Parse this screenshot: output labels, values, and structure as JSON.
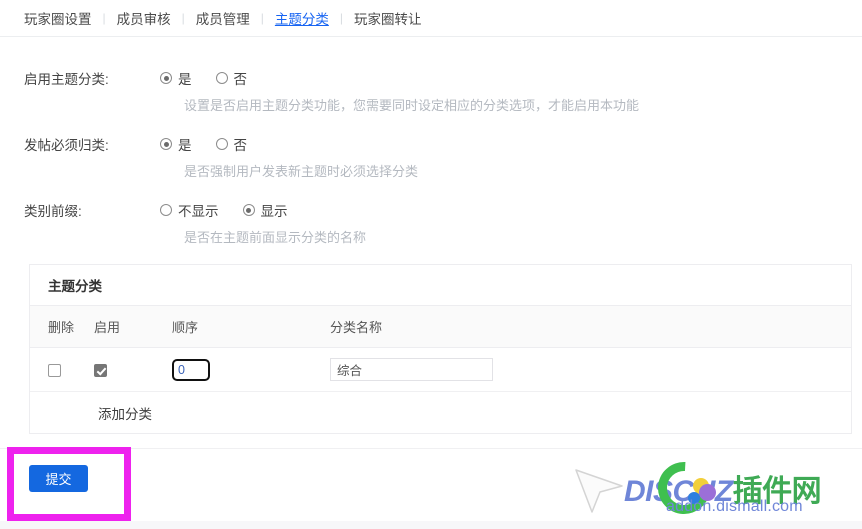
{
  "tabs": [
    {
      "label": "玩家圈设置",
      "active": false
    },
    {
      "label": "成员审核",
      "active": false
    },
    {
      "label": "成员管理",
      "active": false
    },
    {
      "label": "主题分类",
      "active": true
    },
    {
      "label": "玩家圈转让",
      "active": false
    }
  ],
  "separator": "|",
  "form": {
    "rows": [
      {
        "label": "启用主题分类:",
        "options": [
          {
            "label": "是",
            "selected": true
          },
          {
            "label": "否",
            "selected": false
          }
        ],
        "hint": "设置是否启用主题分类功能，您需要同时设定相应的分类选项，才能启用本功能"
      },
      {
        "label": "发帖必须归类:",
        "options": [
          {
            "label": "是",
            "selected": true
          },
          {
            "label": "否",
            "selected": false
          }
        ],
        "hint": "是否强制用户发表新主题时必须选择分类"
      },
      {
        "label": "类别前缀:",
        "options": [
          {
            "label": "不显示",
            "selected": false
          },
          {
            "label": "显示",
            "selected": true
          }
        ],
        "hint": "是否在主题前面显示分类的名称"
      }
    ]
  },
  "panel": {
    "title": "主题分类",
    "columns": [
      "删除",
      "启用",
      "顺序",
      "分类名称"
    ],
    "rows": [
      {
        "delete_checked": false,
        "enable_checked": true,
        "order_value": "0",
        "name_value": "综合"
      }
    ],
    "add_link": "添加分类"
  },
  "footer": {
    "submit_label": "提交"
  },
  "watermark": {
    "brand_main": "DISCUZ",
    "brand_cn": "插件网",
    "url": "addon.dismall.com"
  },
  "colors": {
    "accent_blue": "#1468e0",
    "tab_active": "#1764f2",
    "annotation": "#ee22ee",
    "hint_gray": "#b4b9c0"
  }
}
